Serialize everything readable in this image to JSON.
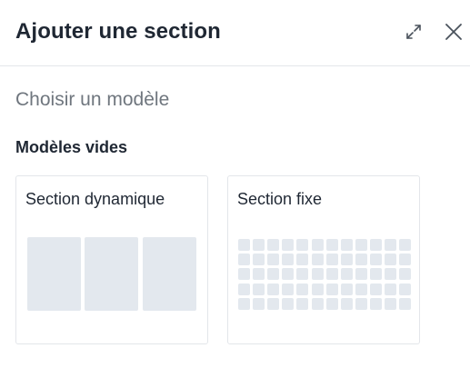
{
  "dialog": {
    "title": "Ajouter une section",
    "expand_icon": "expand-arrows-icon",
    "close_icon": "close-icon"
  },
  "main": {
    "subtitle": "Choisir un modèle",
    "group_label": "Modèles vides",
    "templates": [
      {
        "label": "Section dynamique",
        "preview": "three-columns"
      },
      {
        "label": "Section fixe",
        "preview": "grid"
      }
    ]
  },
  "colors": {
    "title_text": "#1f2733",
    "muted_text": "#6f767e",
    "border": "#e3e6ea",
    "preview_fill": "#e3e8ee"
  }
}
